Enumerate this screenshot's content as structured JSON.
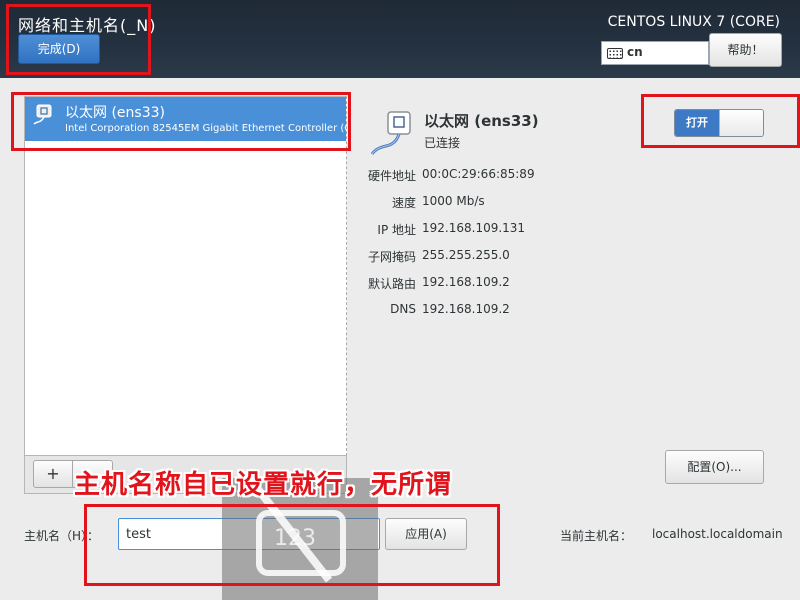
{
  "header": {
    "title": "网络和主机名(_N)",
    "done_label": "完成(D)",
    "product": "CENTOS LINUX 7 (CORE)",
    "keyboard_layout": "cn",
    "help_label": "帮助！"
  },
  "device_list": {
    "items": [
      {
        "name": "以太网 (ens33)",
        "description": "Intel Corporation 82545EM Gigabit Ethernet Controller (Co",
        "icon": "ethernet-icon",
        "selected": true
      }
    ],
    "add_label": "+",
    "remove_label": "–"
  },
  "detail": {
    "name": "以太网 (ens33)",
    "status": "已连接",
    "icon": "ethernet-icon",
    "toggle_label": "打开",
    "toggle_on": true,
    "rows": [
      {
        "label": "硬件地址",
        "value": "00:0C:29:66:85:89"
      },
      {
        "label": "速度",
        "value": "1000 Mb/s"
      },
      {
        "label": "IP 地址",
        "value": "192.168.109.131"
      },
      {
        "label": "子网掩码",
        "value": "255.255.255.0"
      },
      {
        "label": "默认路由",
        "value": "192.168.109.2"
      },
      {
        "label": "DNS",
        "value": "192.168.109.2"
      }
    ],
    "config_label": "配置(O)..."
  },
  "hostname": {
    "label": "主机名（H）：",
    "value": "test",
    "apply_label": "应用(A)",
    "current_label": "当前主机名：",
    "current_value": "localhost.localdomain"
  },
  "osk": {
    "text": "123"
  },
  "annotation": {
    "text": "主机名称自已设置就行，无所谓",
    "color": "#e1141c"
  },
  "colors": {
    "accent": "#4a90d9",
    "header_bg": "#243140",
    "annotation": "#e1141c"
  }
}
